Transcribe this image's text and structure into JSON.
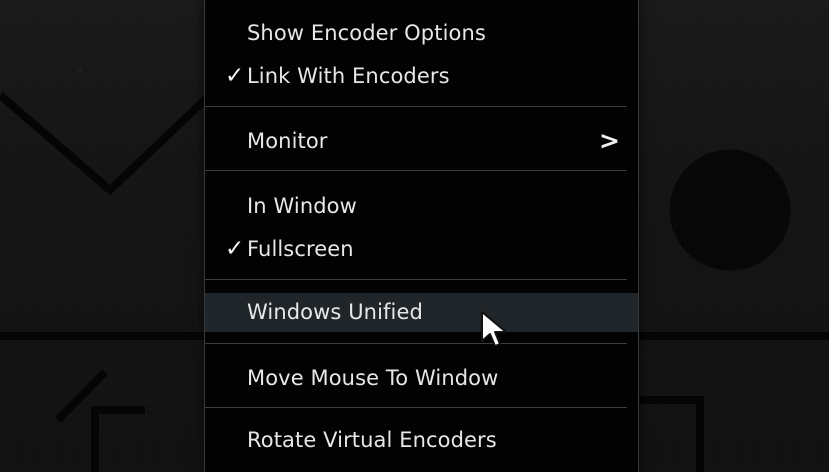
{
  "menu": {
    "items": [
      {
        "label": "Show Encoder Options",
        "checked": false
      },
      {
        "label": "Link With Encoders",
        "checked": true
      },
      {
        "label": "Monitor",
        "submenu": true
      },
      {
        "label": "In Window",
        "checked": false
      },
      {
        "label": "Fullscreen",
        "checked": true
      },
      {
        "label": "Windows Unified",
        "highlighted": true
      },
      {
        "label": "Move Mouse To Window"
      },
      {
        "label": "Rotate Virtual Encoders"
      }
    ],
    "check_mark": "✓",
    "submenu_arrow": ">"
  },
  "icons": {
    "cursor": "mouse-pointer-icon"
  }
}
